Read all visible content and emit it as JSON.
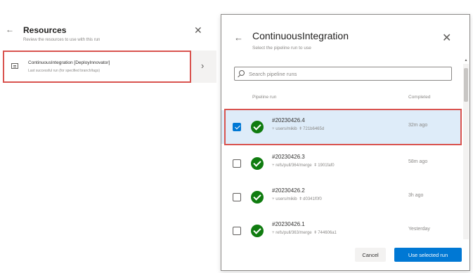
{
  "resources_panel": {
    "title": "Resources",
    "subtitle": "Review the resources to use with this run",
    "back_glyph": "←",
    "close_glyph": "✕",
    "chevron_glyph": "›",
    "resource": {
      "title": "ContinuousIntegration [DeployInnovator]",
      "subtitle": "Last successful run (for specified branch/tags)"
    }
  },
  "dialog": {
    "title": "ContinuousIntegration",
    "subtitle": "Select the pipeline run to use",
    "back_glyph": "←",
    "close_glyph": "✕",
    "search": {
      "placeholder": "Search pipeline runs",
      "value": ""
    },
    "columns": {
      "run": "Pipeline run",
      "completed": "Completed"
    },
    "runs": [
      {
        "id": "#20230426.4",
        "branch": "users/mikib",
        "commit": "721b6465d",
        "completed": "32m ago",
        "checked": true,
        "status": "succeeded"
      },
      {
        "id": "#20230426.3",
        "branch": "refs/pull/364/merge",
        "commit": "1901faf0",
        "completed": "58m ago",
        "checked": false,
        "status": "succeeded"
      },
      {
        "id": "#20230426.2",
        "branch": "users/mikib",
        "commit": "d0341f0f0",
        "completed": "3h ago",
        "checked": false,
        "status": "succeeded"
      },
      {
        "id": "#20230426.1",
        "branch": "refs/pull/363/merge",
        "commit": "744606a1",
        "completed": "Yesterday",
        "checked": false,
        "status": "succeeded"
      }
    ],
    "branch_glyph": "⑂",
    "commit_glyph": "ǂ",
    "cancel_label": "Cancel",
    "primary_label": "Use selected run"
  },
  "colors": {
    "accent": "#0078d4",
    "success": "#107c10",
    "highlight": "#d9534f",
    "selected_row": "#deecf9"
  },
  "icons": [
    "back-arrow-icon",
    "close-icon",
    "pipeline-icon",
    "chevron-right-icon",
    "search-icon",
    "checkbox-icon",
    "success-check-icon",
    "branch-icon",
    "commit-icon"
  ]
}
